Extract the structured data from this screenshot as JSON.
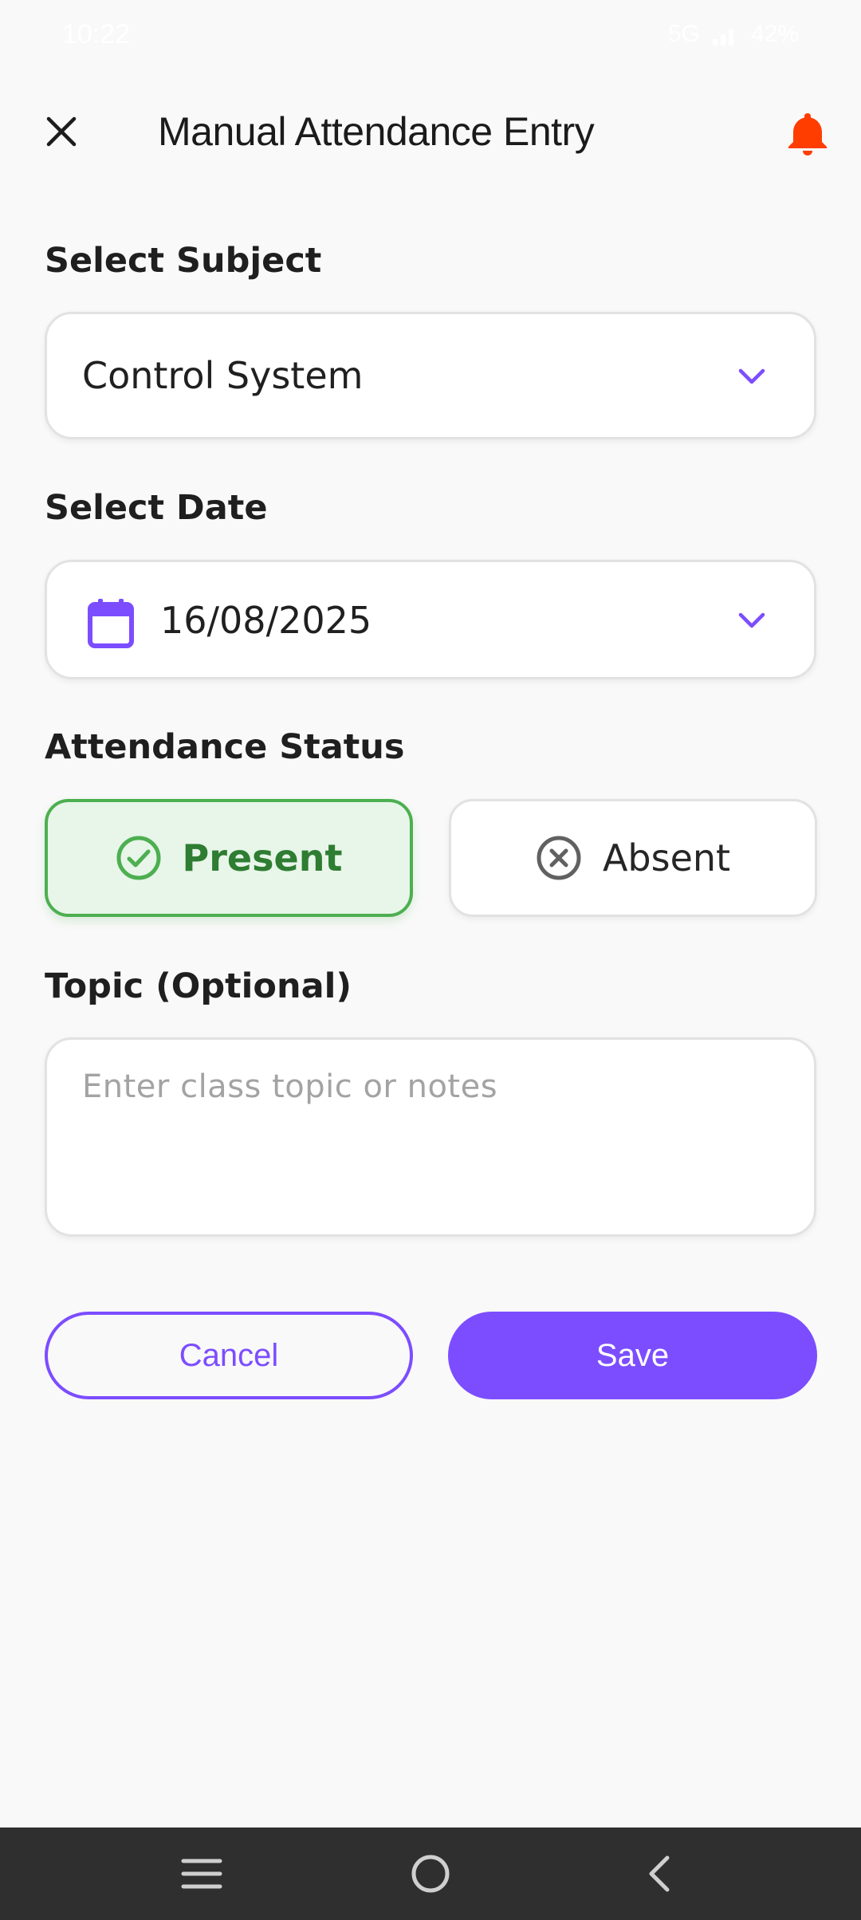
{
  "status_bar": {
    "time": "10:22",
    "battery": "42%",
    "network": "5G"
  },
  "app_bar": {
    "title": "Manual Attendance Entry"
  },
  "form": {
    "subject": {
      "label": "Select Subject",
      "value": "Control System"
    },
    "date": {
      "label": "Select Date",
      "value": "16/08/2025"
    },
    "status": {
      "label": "Attendance Status",
      "options": [
        {
          "label": "Present",
          "selected": true
        },
        {
          "label": "Absent",
          "selected": false
        }
      ]
    },
    "topic": {
      "label": "Topic (Optional)",
      "placeholder": "Enter class topic or notes",
      "value": ""
    }
  },
  "actions": {
    "cancel_label": "Cancel",
    "save_label": "Save"
  },
  "colors": {
    "accent": "#7c4dff",
    "present_green": "#4caf50",
    "present_text": "#2e7d32",
    "bell": "#ff3d00",
    "nav_bg": "#2f2f2f"
  },
  "icons": {
    "close": "close-icon",
    "bell": "bell-icon",
    "chevron": "chevron-down-icon",
    "calendar": "calendar-icon",
    "check": "check-circle-icon",
    "cross": "x-circle-icon",
    "nav": [
      "menu-icon",
      "home-circle-icon",
      "back-icon"
    ]
  }
}
